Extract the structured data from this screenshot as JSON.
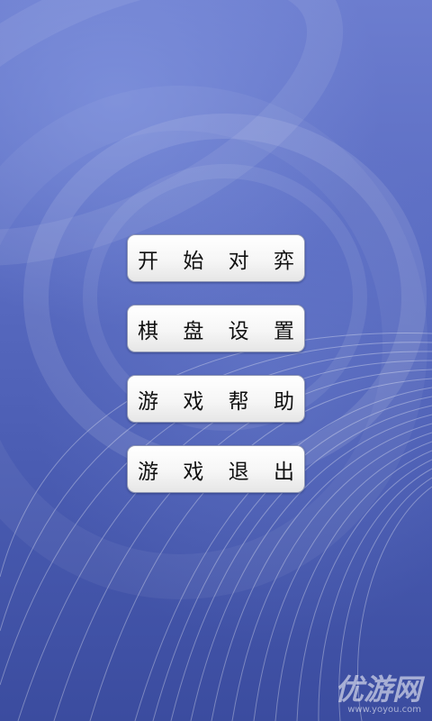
{
  "menu": {
    "items": [
      {
        "label": "开 始 对 弈"
      },
      {
        "label": "棋 盘 设 置"
      },
      {
        "label": "游 戏 帮 助"
      },
      {
        "label": "游 戏 退 出"
      }
    ]
  },
  "watermark": {
    "logo": "优游网",
    "url": "www.yoyou.com"
  },
  "colors": {
    "background_top": "#6c7dcf",
    "background_bottom": "#3b4c9f",
    "button_face": "#f6f6f6",
    "button_border": "#8e96b4",
    "label_text": "#111111"
  }
}
